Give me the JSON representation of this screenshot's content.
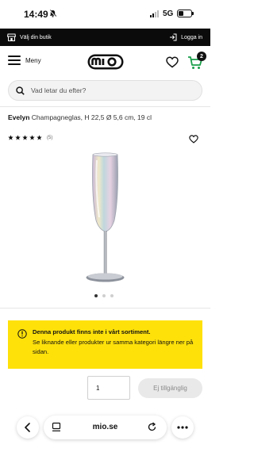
{
  "status_bar": {
    "time": "14:49",
    "network": "5G"
  },
  "top_bar": {
    "store_label": "Välj din butik",
    "login_label": "Logga in"
  },
  "header": {
    "menu_label": "Meny",
    "cart_count": "2"
  },
  "search": {
    "placeholder": "Vad letar du efter?"
  },
  "product": {
    "brand": "Evelyn",
    "description": "Champagneglas, H 22,5 Ø 5,6 cm, 19 cl",
    "review_count": "(5)",
    "rating": 5,
    "rating_max": 5,
    "image_count": 3,
    "active_image": 1
  },
  "notice": {
    "title": "Denna produkt finns inte i vårt sortiment.",
    "body": "Se liknande eller produkter ur samma kategori längre ner på sidan."
  },
  "purchase": {
    "quantity": "1",
    "button_label": "Ej tillgänglig"
  },
  "browser": {
    "url": "mio.se"
  },
  "colors": {
    "notice_bg": "#ffe10a",
    "top_bar_bg": "#0b0b0b",
    "cart_badge_bg": "#111111"
  },
  "icons": [
    "bell-mute-icon",
    "store-icon",
    "login-icon",
    "menu-icon",
    "mio-logo",
    "heart-icon",
    "cart-icon",
    "search-icon",
    "star-icon",
    "info-icon",
    "back-icon",
    "tabs-icon",
    "reload-icon",
    "more-icon"
  ]
}
